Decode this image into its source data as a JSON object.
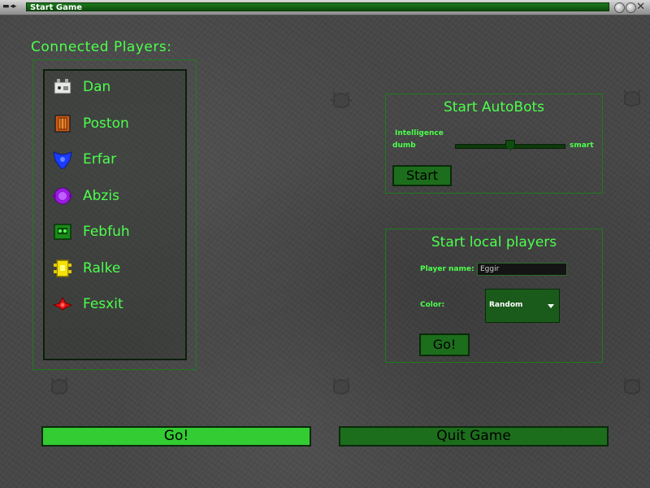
{
  "window": {
    "title": "Start Game",
    "menu_glyph": "▬ ◂▸",
    "buttons": [
      "minimize",
      "maximize",
      "close"
    ],
    "close_glyph": "✕"
  },
  "connected": {
    "heading": "Connected Players:",
    "players": [
      {
        "name": "Dan",
        "icon": "white-robot-icon"
      },
      {
        "name": "Poston",
        "icon": "orange-robot-icon"
      },
      {
        "name": "Erfar",
        "icon": "blue-robot-icon"
      },
      {
        "name": "Abzis",
        "icon": "purple-robot-icon"
      },
      {
        "name": "Febfuh",
        "icon": "green-robot-icon"
      },
      {
        "name": "Ralke",
        "icon": "yellow-robot-icon"
      },
      {
        "name": "Fesxit",
        "icon": "red-robot-icon"
      }
    ]
  },
  "autobots": {
    "title": "Start AutoBots",
    "slider_label": "Intelligence",
    "min_label": "dumb",
    "max_label": "smart",
    "slider_value": 0.5,
    "start_label": "Start"
  },
  "local": {
    "title": "Start local players",
    "name_label": "Player name:",
    "name_value": "Eggir",
    "color_label": "Color:",
    "color_value": "Random",
    "go_label": "Go!"
  },
  "bottom": {
    "go_label": "Go!",
    "quit_label": "Quit Game"
  },
  "colors": {
    "accent": "#4cff4c",
    "button": "#1c6e1c",
    "button_bright": "#33cc33",
    "frame": "#1f7a1f"
  }
}
